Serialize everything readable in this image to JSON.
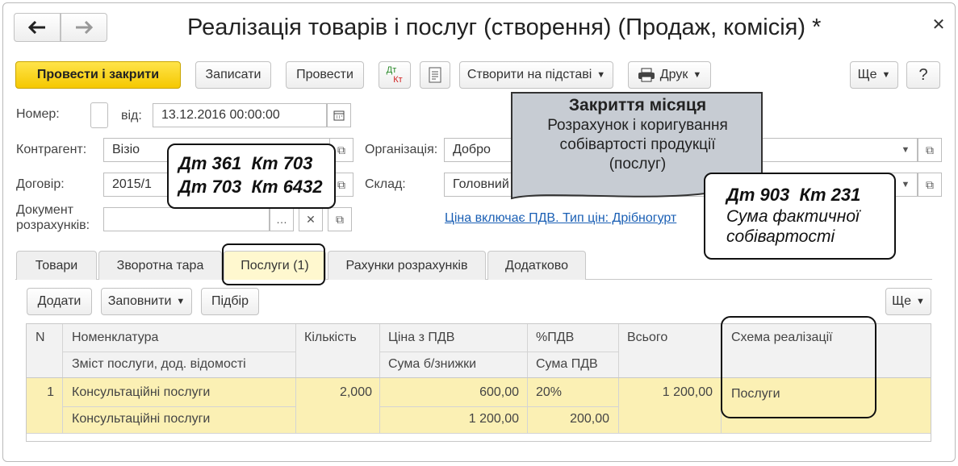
{
  "window": {
    "title": "Реалізація товарів і послуг (створення) (Продаж, комісія) *"
  },
  "toolbar": {
    "post_close": "Провести і закрити",
    "save": "Записати",
    "post": "Провести",
    "dt": "Дт",
    "kt": "Кт",
    "create_based": "Створити на підставі",
    "print": "Друк",
    "more": "Ще",
    "help": "?"
  },
  "header": {
    "number_label": "Номер:",
    "number_value": "",
    "date_label": "від:",
    "date_value": "13.12.2016 00:00:00",
    "contractor_label": "Контрагент:",
    "contractor_value": "Візіо",
    "contract_label": "Договір:",
    "contract_value": "2015/1",
    "settlement_label_1": "Документ",
    "settlement_label_2": "розрахунків:",
    "settlement_value": "",
    "organization_label": "Організація:",
    "organization_value": "Добро",
    "warehouse_label": "Склад:",
    "warehouse_value": "Головний",
    "price_link": "Ціна включає ПДВ. Тип цін: Дрібногурт"
  },
  "tabs": [
    {
      "label": "Товари"
    },
    {
      "label": "Зворотна тара"
    },
    {
      "label": "Послуги (1)"
    },
    {
      "label": "Рахунки розрахунків"
    },
    {
      "label": "Додатково"
    }
  ],
  "table_toolbar": {
    "add": "Додати",
    "fill": "Заповнити",
    "pick": "Підбір",
    "more": "Ще"
  },
  "table": {
    "headers": {
      "n": "N",
      "nomenclature": "Номенклатура",
      "content": "Зміст послуги, дод. відомості",
      "qty": "Кількість",
      "price": "Ціна з ПДВ",
      "sum_no_disc": "Сума б/знижки",
      "vat_pct": "%ПДВ",
      "vat_sum": "Сума ПДВ",
      "total": "Всього",
      "scheme": "Схема реалізації"
    },
    "rows": [
      {
        "n": "1",
        "nomenclature": "Консультаційні послуги",
        "content": "Консультаційні послуги",
        "qty": "2,000",
        "price": "600,00",
        "sum_no_disc": "1 200,00",
        "vat_pct": "20%",
        "vat_sum": "200,00",
        "total": "1 200,00",
        "scheme": "Послуги"
      }
    ]
  },
  "callouts": {
    "entries": {
      "line1": "Дт 361  Кт 703",
      "line2": "Дт 703  Кт 6432"
    },
    "month_close": {
      "title": "Закриття  місяця",
      "line1": "Розрахунок і коригування",
      "line2": "собівартості продукції",
      "line3": "(послуг)"
    },
    "cost": {
      "title": "Дт 903  Кт 231",
      "line1": "Сума фактичної",
      "line2": "собівартості"
    }
  },
  "colors": {
    "accent_yellow": "#f5c800",
    "row_highlight": "#fbf0b4",
    "link": "#1a5fb4",
    "callout_fill": "#c7ccd3"
  },
  "icons": [
    "arrow-left-icon",
    "arrow-right-icon",
    "close-icon",
    "calendar-icon",
    "dropdown-icon",
    "open-icon",
    "printer-icon",
    "report-icon",
    "clear-icon"
  ]
}
